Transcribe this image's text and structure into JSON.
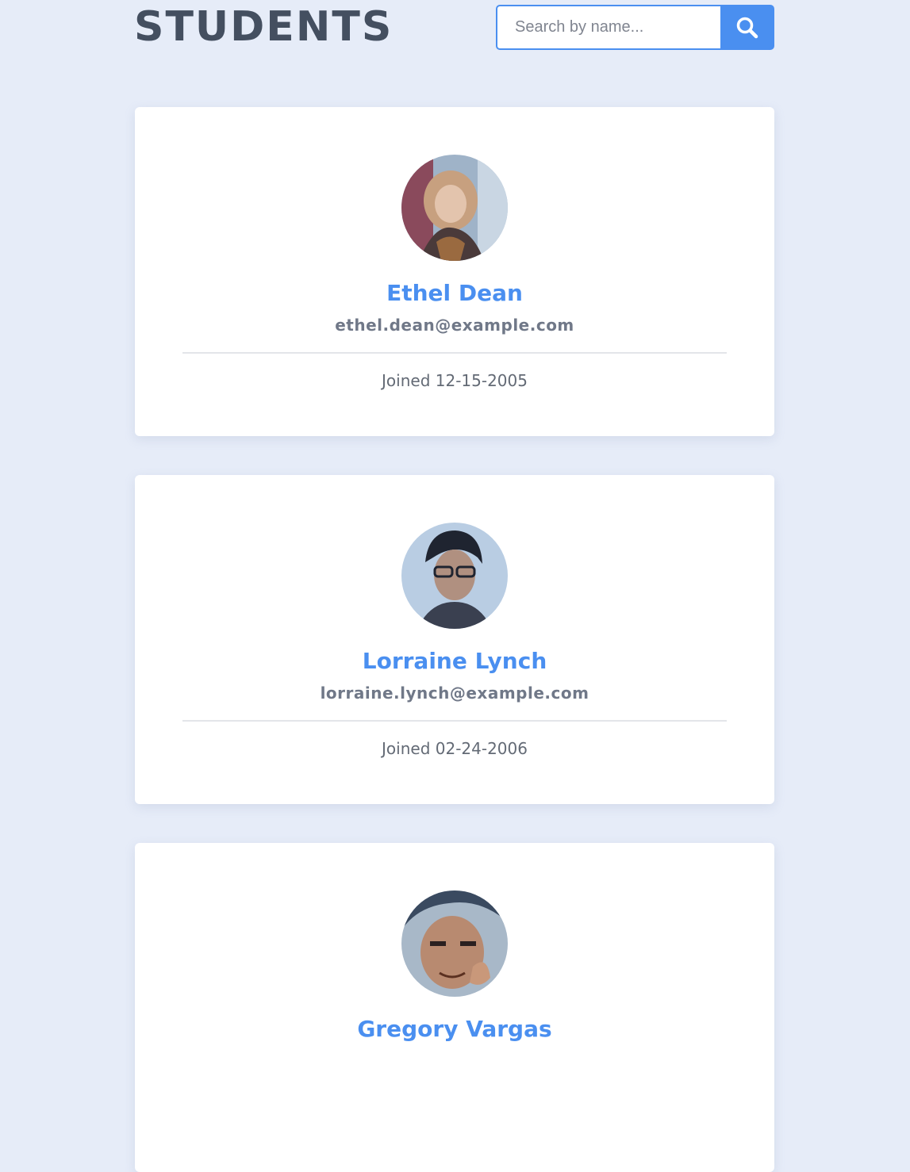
{
  "header": {
    "title": "STUDENTS",
    "search_placeholder": "Search by name...",
    "search_icon": "search-icon"
  },
  "colors": {
    "background": "#e6ecf8",
    "accent": "#4a8ff0",
    "title": "#444f60",
    "email": "#707888",
    "joined": "#636a75"
  },
  "students": [
    {
      "name": "Ethel Dean",
      "email": "ethel.dean@example.com",
      "joined": "Joined 12-15-2005",
      "avatar_icon": "avatar-photo"
    },
    {
      "name": "Lorraine Lynch",
      "email": "lorraine.lynch@example.com",
      "joined": "Joined 02-24-2006",
      "avatar_icon": "avatar-photo"
    },
    {
      "name": "Gregory Vargas",
      "avatar_icon": "avatar-photo"
    }
  ]
}
